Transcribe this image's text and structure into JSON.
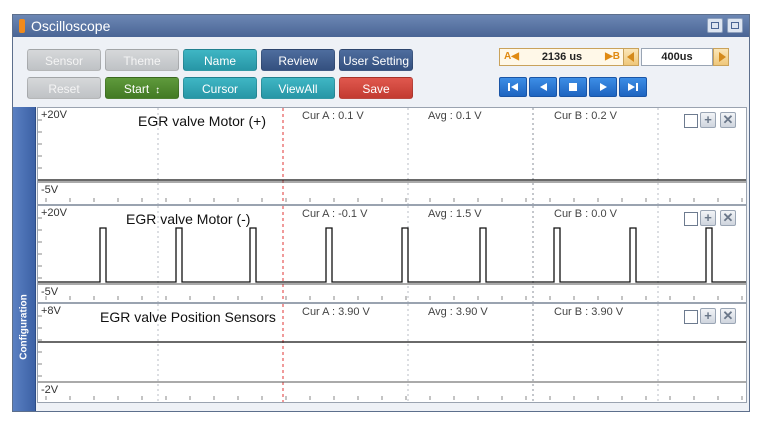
{
  "window": {
    "title": "Oscilloscope",
    "icons": [
      "capture-icon",
      "menu-icon"
    ]
  },
  "toolbar": {
    "row1": [
      {
        "label": "Sensor",
        "state": "disabled"
      },
      {
        "label": "Theme",
        "state": "disabled"
      },
      {
        "label": "Name",
        "state": "active"
      },
      {
        "label": "Review",
        "state": "active"
      },
      {
        "label": "User Setting",
        "state": "active"
      }
    ],
    "row2": [
      {
        "label": "Reset",
        "state": "disabled"
      },
      {
        "label": "Start",
        "state": "active"
      },
      {
        "label": "Cursor",
        "state": "active"
      },
      {
        "label": "ViewAll",
        "state": "active"
      },
      {
        "label": "Save",
        "state": "active"
      }
    ]
  },
  "timebase": {
    "marker_a": "A◀",
    "marker_b": "▶B",
    "time_value": "2136 us",
    "division_value": "400us"
  },
  "playback": [
    "skip-first-icon",
    "prev-icon",
    "stop-icon",
    "play-icon",
    "skip-last-icon"
  ],
  "sidebar": {
    "label": "Configuration"
  },
  "channels": [
    {
      "name": "EGR valve Motor (+)",
      "y_top": "+20V",
      "y_bottom": "-5V",
      "cur_a": "Cur A : 0.1 V",
      "avg": "Avg : 0.1 V",
      "cur_b": "Cur B : 0.2 V",
      "signal": "flat-low"
    },
    {
      "name": "EGR valve Motor (-)",
      "y_top": "+20V",
      "y_bottom": "-5V",
      "cur_a": "Cur A : -0.1 V",
      "avg": "Avg : 1.5 V",
      "cur_b": "Cur B : 0.0 V",
      "signal": "pulse-train"
    },
    {
      "name": "EGR valve Position Sensors",
      "y_top": "+8V",
      "y_bottom": "-2V",
      "cur_a": "Cur A : 3.90 V",
      "avg": "Avg : 3.90 V",
      "cur_b": "Cur B : 3.90 V",
      "signal": "flat-mid"
    }
  ],
  "colors": {
    "cursor_a": "#e03434",
    "trace": "#111111",
    "accent": "#4a6595"
  }
}
